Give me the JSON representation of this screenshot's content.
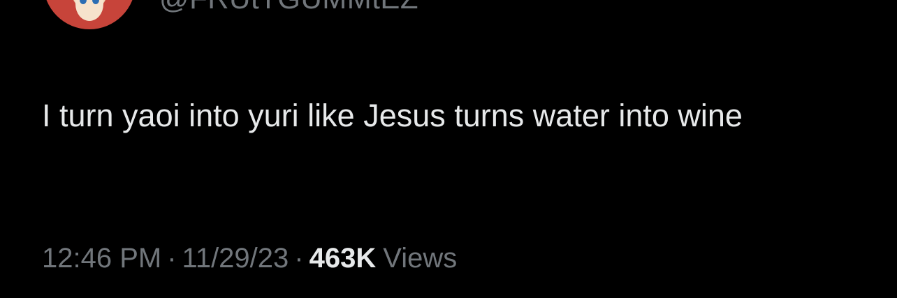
{
  "author": {
    "handle": "@FRUtTGUMMtEZ"
  },
  "tweet": {
    "text": "I turn yaoi into yuri like Jesus turns water into wine",
    "time": "12:46 PM",
    "separator": "·",
    "date": "11/29/23",
    "views_count": "463K",
    "views_label": "Views"
  },
  "colors": {
    "background": "#000000",
    "text_primary": "#e7e9ea",
    "text_secondary": "#71767b"
  }
}
